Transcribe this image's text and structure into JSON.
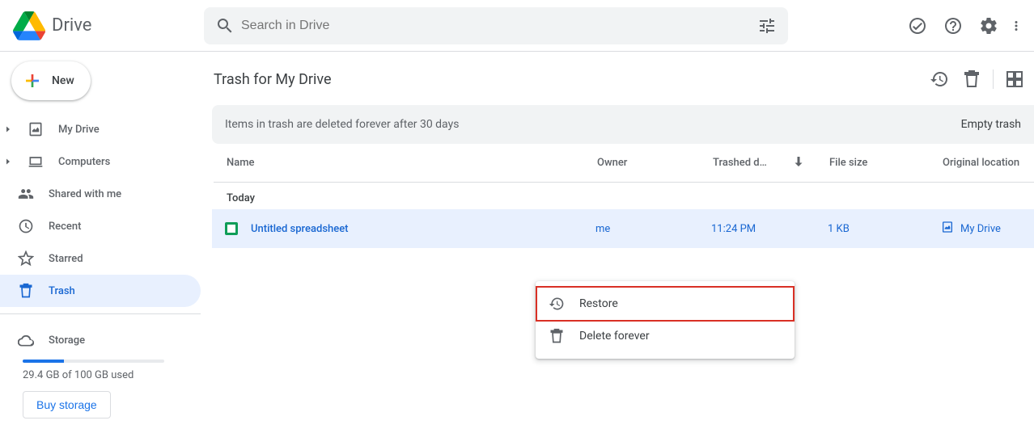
{
  "product_name": "Drive",
  "search": {
    "placeholder": "Search in Drive"
  },
  "new_button": "New",
  "sidebar": {
    "items": [
      {
        "label": "My Drive"
      },
      {
        "label": "Computers"
      },
      {
        "label": "Shared with me"
      },
      {
        "label": "Recent"
      },
      {
        "label": "Starred"
      },
      {
        "label": "Trash"
      },
      {
        "label": "Storage"
      }
    ]
  },
  "storage": {
    "used": "29.4 GB of 100 GB used",
    "buy": "Buy storage"
  },
  "page_title": "Trash for My Drive",
  "notice": {
    "text": "Items in trash are deleted forever after 30 days",
    "action": "Empty trash"
  },
  "columns": {
    "name": "Name",
    "owner": "Owner",
    "trashed": "Trashed d…",
    "size": "File size",
    "orig": "Original location"
  },
  "groups": [
    {
      "label": "Today"
    }
  ],
  "rows": [
    {
      "name": "Untitled spreadsheet",
      "owner": "me",
      "trashed": "11:24 PM",
      "size": "1 KB",
      "orig": "My Drive"
    }
  ],
  "context_menu": {
    "restore": "Restore",
    "delete": "Delete forever"
  }
}
